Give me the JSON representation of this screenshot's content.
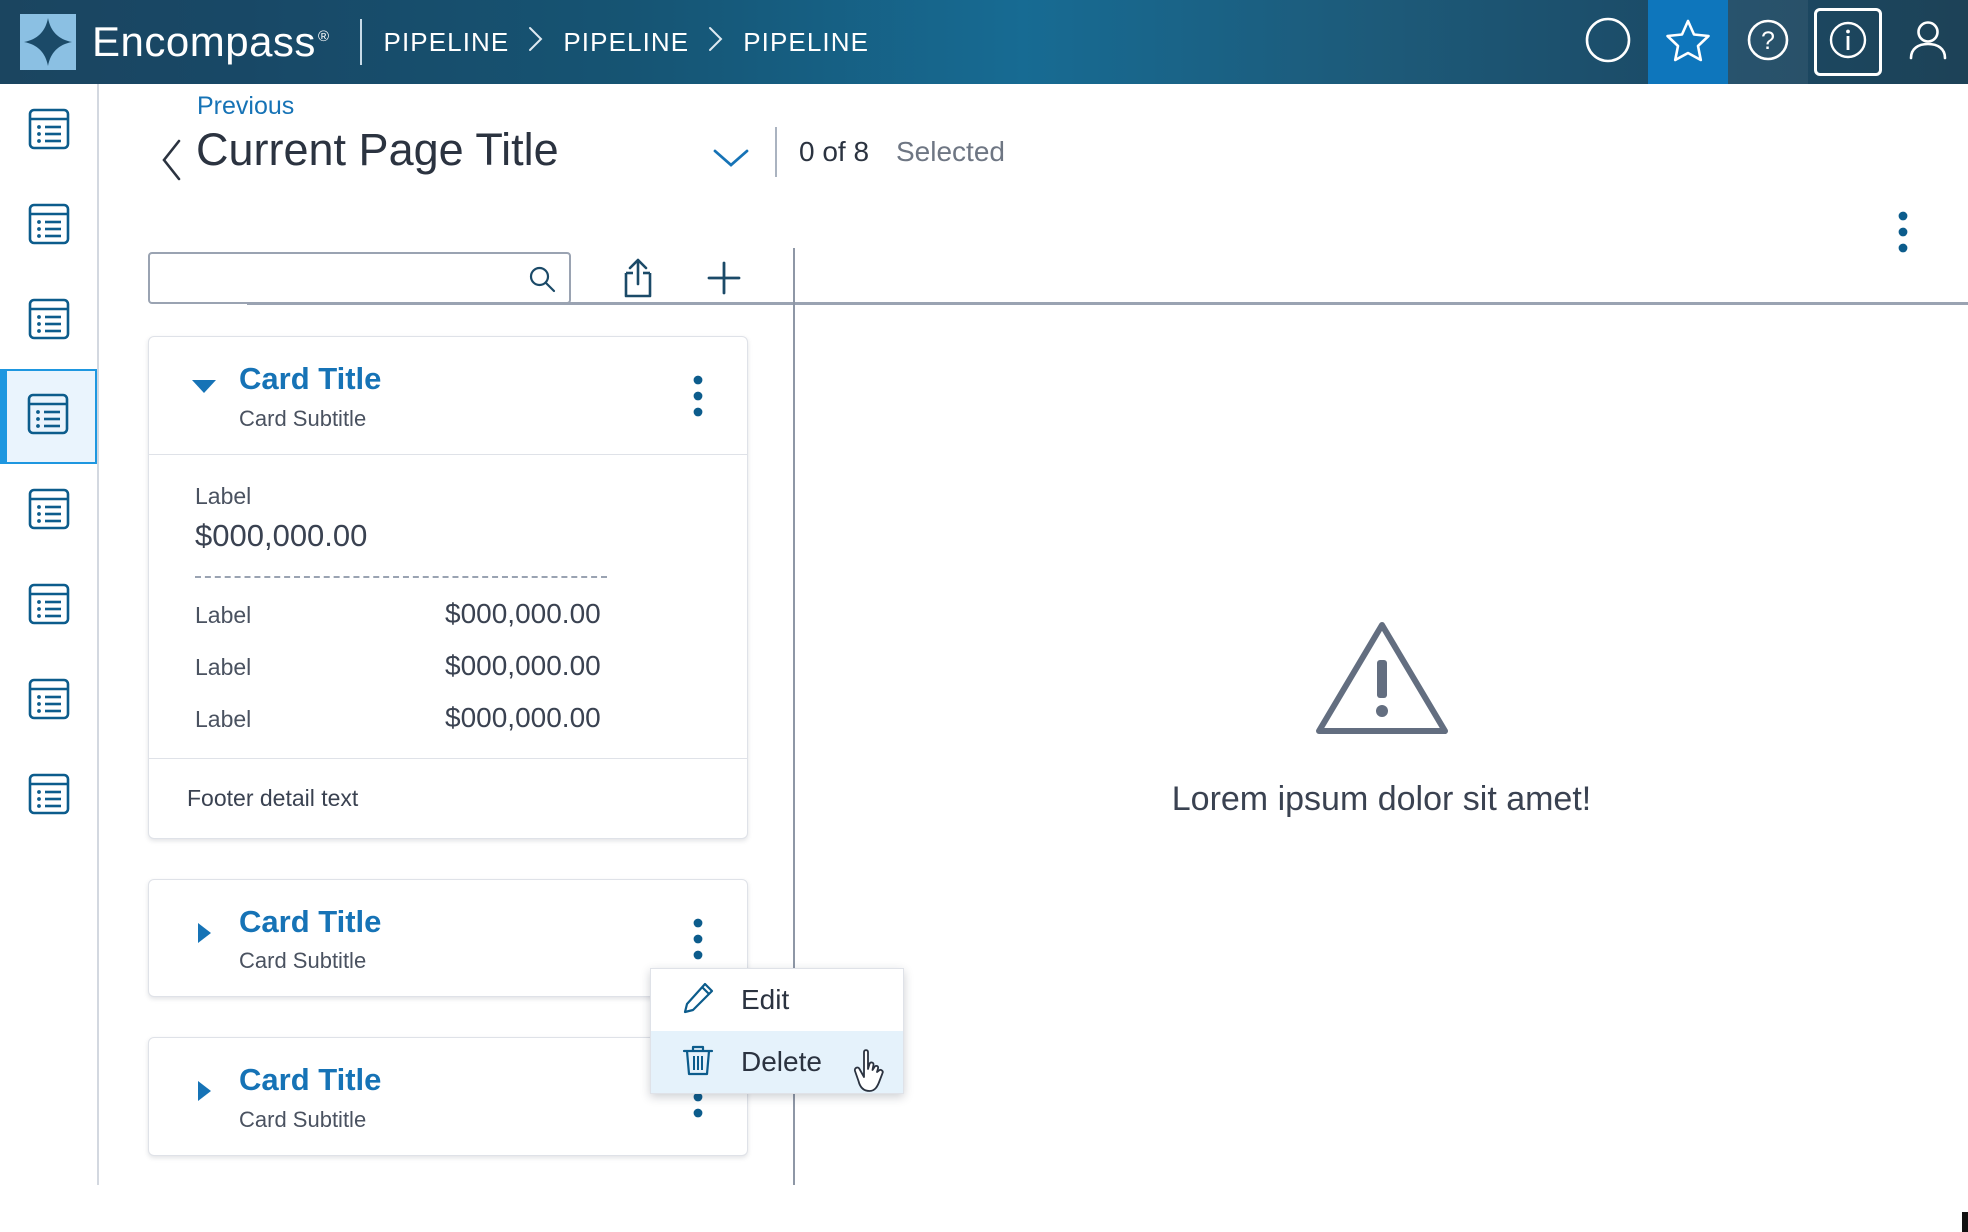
{
  "brand": {
    "name": "Encompass",
    "registered": "®",
    "logo_icon": "encompass-diamond-logo"
  },
  "header": {
    "breadcrumb": [
      "PIPELINE",
      "PIPELINE",
      "PIPELINE"
    ],
    "separator": "›",
    "actions": [
      {
        "name": "circle-icon",
        "label": ""
      },
      {
        "name": "star-icon",
        "label": ""
      },
      {
        "name": "help-icon",
        "label": "?"
      },
      {
        "name": "info-icon",
        "label": "i"
      },
      {
        "name": "user-account-icon",
        "label": ""
      }
    ],
    "colors": {
      "gradient_left": "#1b4560",
      "gradient_mid": "#176b93",
      "gradient_right": "#1d4257",
      "star_active_bg": "#0e76bc"
    }
  },
  "sidebar": {
    "items": [
      {
        "label": "",
        "icon": "list-icon",
        "selected": false
      },
      {
        "label": "",
        "icon": "list-icon",
        "selected": false
      },
      {
        "label": "",
        "icon": "list-icon",
        "selected": false
      },
      {
        "label": "",
        "icon": "list-icon",
        "selected": true
      },
      {
        "label": "",
        "icon": "list-icon",
        "selected": false
      },
      {
        "label": "",
        "icon": "list-icon",
        "selected": false
      },
      {
        "label": "",
        "icon": "list-icon",
        "selected": false
      },
      {
        "label": "",
        "icon": "list-icon",
        "selected": false
      }
    ],
    "selected_color": "#1e97e0",
    "selected_bg": "#eaf4fd"
  },
  "page": {
    "previous_link": "Previous",
    "title": "Current Page Title",
    "selection_count": "0 of 8",
    "selection_label": "Selected",
    "back_icon": "chevron-left-icon",
    "title_caret_icon": "chevron-down-icon",
    "overflow_icon": "kebab-menu-icon"
  },
  "toolbar": {
    "search_value": "",
    "search_placeholder": "",
    "search_icon": "search-icon",
    "export_icon": "share-export-icon",
    "add_icon": "plus-icon"
  },
  "cards": [
    {
      "expanded": true,
      "title": "Card Title",
      "subtitle": "Card Subtitle",
      "toggle_icon": "triangle-down-icon",
      "overflow_icon": "kebab-menu-icon",
      "summary": {
        "label": "Label",
        "value": "$000,000.00"
      },
      "rows": [
        {
          "label": "Label",
          "value": "$000,000.00"
        },
        {
          "label": "Label",
          "value": "$000,000.00"
        },
        {
          "label": "Label",
          "value": "$000,000.00"
        }
      ],
      "footer": "Footer detail text"
    },
    {
      "expanded": false,
      "title": "Card Title",
      "subtitle": "Card Subtitle",
      "toggle_icon": "triangle-right-icon",
      "overflow_icon": "kebab-menu-icon"
    },
    {
      "expanded": false,
      "title": "Card Title",
      "subtitle": "Card Subtitle",
      "toggle_icon": "triangle-right-icon",
      "overflow_icon": "kebab-menu-icon"
    }
  ],
  "context_menu": {
    "items": [
      {
        "label": "Edit",
        "icon": "pencil-icon",
        "active": false
      },
      {
        "label": "Delete",
        "icon": "trash-icon",
        "active": true
      }
    ],
    "highlight_color": "#e5f2fb",
    "cursor_icon": "pointing-hand-cursor"
  },
  "detail_panel": {
    "icon": "warning-triangle-icon",
    "message": "Lorem ipsum dolor sit amet!"
  },
  "colors": {
    "accent_blue": "#1673b6",
    "link_blue": "#1673b6",
    "text_dark": "#2b3340",
    "text_muted": "#6e7683",
    "rule": "#9aa3b2",
    "card_border": "#dfe2e8"
  }
}
